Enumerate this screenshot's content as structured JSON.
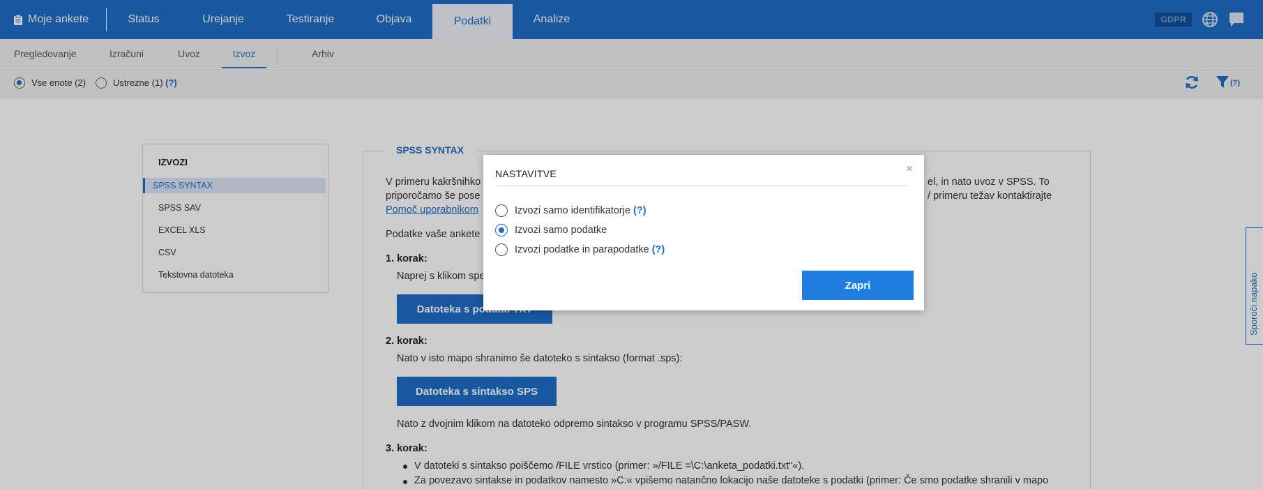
{
  "topnav": {
    "brand": "Moje ankete",
    "tabs": [
      "Status",
      "Urejanje",
      "Testiranje",
      "Objava",
      "Podatki",
      "Analize"
    ],
    "active_tab": "Podatki",
    "gdpr": "GDPR"
  },
  "subnav": {
    "items": [
      "Pregledovanje",
      "Izračuni",
      "Uvoz",
      "Izvoz",
      "Arhiv"
    ],
    "active": "Izvoz"
  },
  "filter": {
    "all_units": "Vse enote (2)",
    "matching": "Ustrezne (1)",
    "help": "(?)",
    "filter_help": "(?)"
  },
  "sidebar": {
    "title": "IZVOZI",
    "items": [
      "SPSS SYNTAX",
      "SPSS SAV",
      "EXCEL XLS",
      "CSV",
      "Tekstovna datoteka"
    ],
    "active": "SPSS SYNTAX"
  },
  "main": {
    "legend": "SPSS SYNTAX",
    "intro_line1_left": "V primeru kakršnihko",
    "intro_line1_right": "el, in nato uvoz v SPSS. To",
    "intro_line2_left": "priporočamo še pose",
    "intro_line2_right": "/ primeru težav kontaktirajte",
    "help_link": "Pomoč uporabnikom",
    "data_intro": "Podatke vaše ankete",
    "step1": "1. korak:",
    "step1_text": "Naprej s klikom spe",
    "btn_data": "Datoteka s podatki TXT",
    "step2": "2. korak:",
    "step2_text": "Nato v isto mapo shranimo še datoteko s sintakso (format .sps):",
    "btn_syntax": "Datoteka s sintakso SPS",
    "step2_after": "Nato z dvojnim klikom na datoteko odpremo sintakso v programu SPSS/PASW.",
    "step3": "3. korak:",
    "bullet1": "V datoteki s sintakso poiščemo /FILE vrstico (primer: »/FILE =\\C:\\anketa_podatki.txt\"«).",
    "bullet2": "Za povezavo sintakse in podatkov namesto »C:« vpišemo natančno lokacijo naše datoteke s podatki (primer: Če smo podatke shranili v mapo"
  },
  "feedback": "Sporoči napako",
  "modal": {
    "title": "NASTAVITVE",
    "close": "×",
    "options": [
      {
        "label": "Izvozi samo identifikatorje",
        "help": "(?)",
        "checked": false
      },
      {
        "label": "Izvozi samo podatke",
        "help": "",
        "checked": true
      },
      {
        "label": "Izvozi podatke in parapodatke",
        "help": "(?)",
        "checked": false
      }
    ],
    "button": "Zapri"
  }
}
